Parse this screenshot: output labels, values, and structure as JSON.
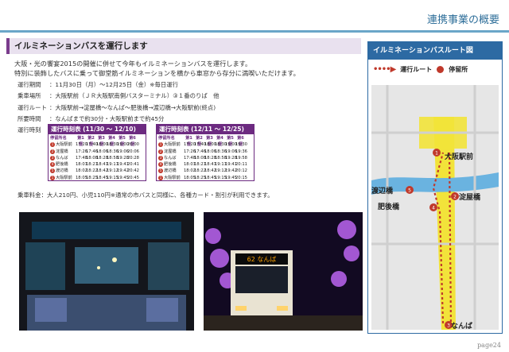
{
  "header": {
    "title": "連携事業の概要"
  },
  "section": {
    "title": "イルミネーションバスを運行します"
  },
  "intro": {
    "line1": "大阪・光の饗宴2015の開催に併せて今年もイルミネーションバスを運行します。",
    "line2": "特別に装飾したバスに乗って御堂筋イルミネーションを横から車窓から存分に満喫いただけます。"
  },
  "info": [
    {
      "label": "運行期間",
      "value": "：11月30日（月）～12月25日（金）※毎日運行"
    },
    {
      "label": "乗車場所",
      "value": "：大阪駅前（ＪＲ大阪駅南側バスターミナル）③１番のりば　他"
    },
    {
      "label": "運行ルート",
      "value": "：大阪駅前→淀屋橋～なんば～肥後橋→渡辺橋→大阪駅前(終点)"
    },
    {
      "label": "所要時間",
      "value": "：なんばまで約30分・大阪駅前まで約45分"
    },
    {
      "label": "運行時刻",
      "value": ""
    }
  ],
  "timetables": [
    {
      "title": "運行時刻表 (11/30 ～ 12/10)",
      "headers": [
        "停留所名",
        "第1便",
        "第2便",
        "第3便",
        "第4便",
        "第5便",
        "第6便"
      ],
      "rows": [
        {
          "n": "1",
          "stop": "大阪駅前",
          "times": [
            "17:20",
            "17:40",
            "18:00",
            "18:30",
            "19:00",
            "20:00"
          ]
        },
        {
          "n": "2",
          "stop": "淀屋橋",
          "times": [
            "17:26",
            "17:46",
            "18:06",
            "18:36",
            "19:06",
            "20:06"
          ]
        },
        {
          "n": "3",
          "stop": "なんば",
          "times": [
            "17:48",
            "18:08",
            "18:28",
            "18:58",
            "19:28",
            "20:28"
          ]
        },
        {
          "n": "4",
          "stop": "肥後橋",
          "times": [
            "18:01",
            "18:21",
            "18:41",
            "19:11",
            "19:41",
            "20:41"
          ]
        },
        {
          "n": "5",
          "stop": "渡辺橋",
          "times": [
            "18:02",
            "18:22",
            "18:42",
            "19:12",
            "19:42",
            "20:42"
          ]
        },
        {
          "n": "1",
          "stop": "大阪駅前",
          "times": [
            "18:05",
            "18:25",
            "18:45",
            "19:15",
            "19:45",
            "20:45"
          ]
        }
      ]
    },
    {
      "title": "運行時刻表 (12/11 ～ 12/25)",
      "headers": [
        "停留所名",
        "第1便",
        "第2便",
        "第3便",
        "第4便",
        "第5便",
        "第6便"
      ],
      "rows": [
        {
          "n": "1",
          "stop": "大阪駅前",
          "times": [
            "17:20",
            "17:40",
            "18:00",
            "18:30",
            "19:00",
            "19:30"
          ]
        },
        {
          "n": "2",
          "stop": "淀屋橋",
          "times": [
            "17:26",
            "17:46",
            "18:06",
            "18:36",
            "19:06",
            "19:36"
          ]
        },
        {
          "n": "3",
          "stop": "なんば",
          "times": [
            "17:48",
            "18:08",
            "18:28",
            "18:58",
            "19:28",
            "19:58"
          ]
        },
        {
          "n": "4",
          "stop": "肥後橋",
          "times": [
            "18:01",
            "18:21",
            "18:41",
            "19:11",
            "19:41",
            "20:11"
          ]
        },
        {
          "n": "5",
          "stop": "渡辺橋",
          "times": [
            "18:02",
            "18:22",
            "18:42",
            "19:12",
            "19:42",
            "20:12"
          ]
        },
        {
          "n": "1",
          "stop": "大阪駅前",
          "times": [
            "18:05",
            "18:25",
            "18:45",
            "19:15",
            "19:45",
            "20:15"
          ]
        }
      ]
    }
  ],
  "fare": "乗車料金：大人210円、小児110円※通常の市バスと同様に、各種カード・割引が利用できます。",
  "map": {
    "title": "イルミネーションバスルート図",
    "legend_route": "運行ルート",
    "legend_stop": "停留所",
    "stops": [
      {
        "n": "1",
        "name": "大阪駅前"
      },
      {
        "n": "2",
        "name": "淀屋橋"
      },
      {
        "n": "3",
        "name": "なんば"
      },
      {
        "n": "4",
        "name": "肥後橋"
      },
      {
        "n": "5",
        "name": "渡辺橋"
      }
    ]
  },
  "page": "page24",
  "colors": {
    "accent": "#6c2a80",
    "header_blue": "#2d6aa3",
    "route_red": "#c0392b",
    "road_yellow": "#f2e33a"
  }
}
